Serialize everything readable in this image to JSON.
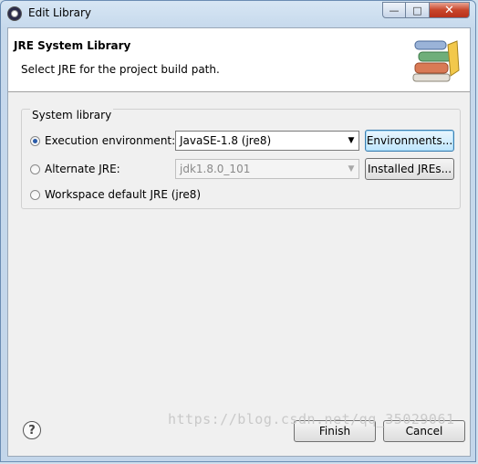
{
  "window": {
    "title": "Edit Library",
    "min_glyph": "—",
    "max_glyph": "□",
    "close_glyph": "✕"
  },
  "header": {
    "title": "JRE System Library",
    "message": "Select JRE for the project build path."
  },
  "group": {
    "label": "System library",
    "options": [
      {
        "label": "Execution environment:",
        "checked": true
      },
      {
        "label": "Alternate JRE:",
        "checked": false
      },
      {
        "label": "Workspace default JRE (jre8)",
        "checked": false
      }
    ],
    "exec_env_value": "JavaSE-1.8 (jre8)",
    "alt_jre_value": "jdk1.8.0_101",
    "environments_button": "Environments...",
    "installed_jres_button": "Installed JREs..."
  },
  "footer": {
    "help_glyph": "?",
    "finish_button": "Finish",
    "cancel_button": "Cancel"
  },
  "watermark": "https://blog.csdn.net/qq_35029061",
  "colors": {
    "accent": "#2a5ba8",
    "titlebar": "#c6d9ec",
    "close": "#c8452a"
  }
}
